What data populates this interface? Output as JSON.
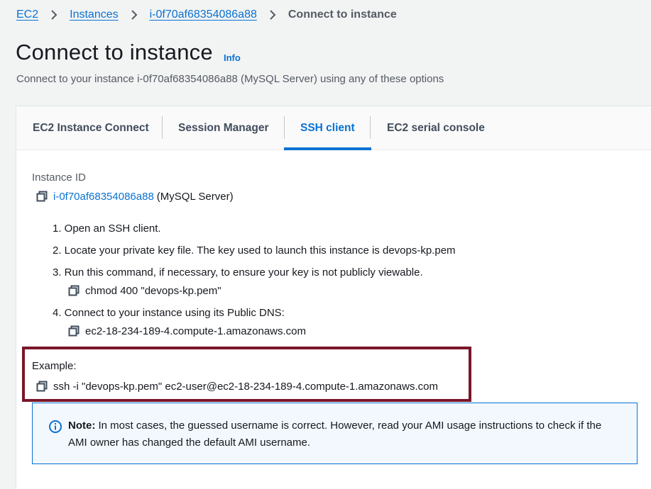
{
  "breadcrumb": {
    "items": [
      "EC2",
      "Instances",
      "i-0f70af68354086a88"
    ],
    "current": "Connect to instance"
  },
  "header": {
    "title": "Connect to instance",
    "info": "Info",
    "description": "Connect to your instance i-0f70af68354086a88 (MySQL Server) using any of these options"
  },
  "tabs": [
    {
      "label": "EC2 Instance Connect"
    },
    {
      "label": "Session Manager"
    },
    {
      "label": "SSH client",
      "active": true
    },
    {
      "label": "EC2 serial console"
    }
  ],
  "ssh": {
    "instance_id_label": "Instance ID",
    "instance_id": "i-0f70af68354086a88",
    "instance_name": "(MySQL Server)",
    "steps": [
      "1. Open an SSH client.",
      "2. Locate your private key file. The key used to launch this instance is devops-kp.pem",
      "3. Run this command, if necessary, to ensure your key is not publicly viewable.",
      "4. Connect to your instance using its Public DNS:"
    ],
    "chmod_command": "chmod 400 \"devops-kp.pem\"",
    "public_dns": "ec2-18-234-189-4.compute-1.amazonaws.com",
    "example_label": "Example:",
    "example_command": "ssh -i \"devops-kp.pem\" ec2-user@ec2-18-234-189-4.compute-1.amazonaws.com"
  },
  "note": {
    "bold": "Note:",
    "text": " In most cases, the guessed username is correct. However, read your AMI usage instructions to check if the AMI owner has changed the default AMI username."
  },
  "colors": {
    "link": "#0972d3",
    "highlight_border": "#7a1629",
    "note_background": "#f2f8fd"
  },
  "icons": {
    "copy": "copy-icon",
    "chevron": "chevron-right-icon",
    "info": "info-circle-icon"
  }
}
